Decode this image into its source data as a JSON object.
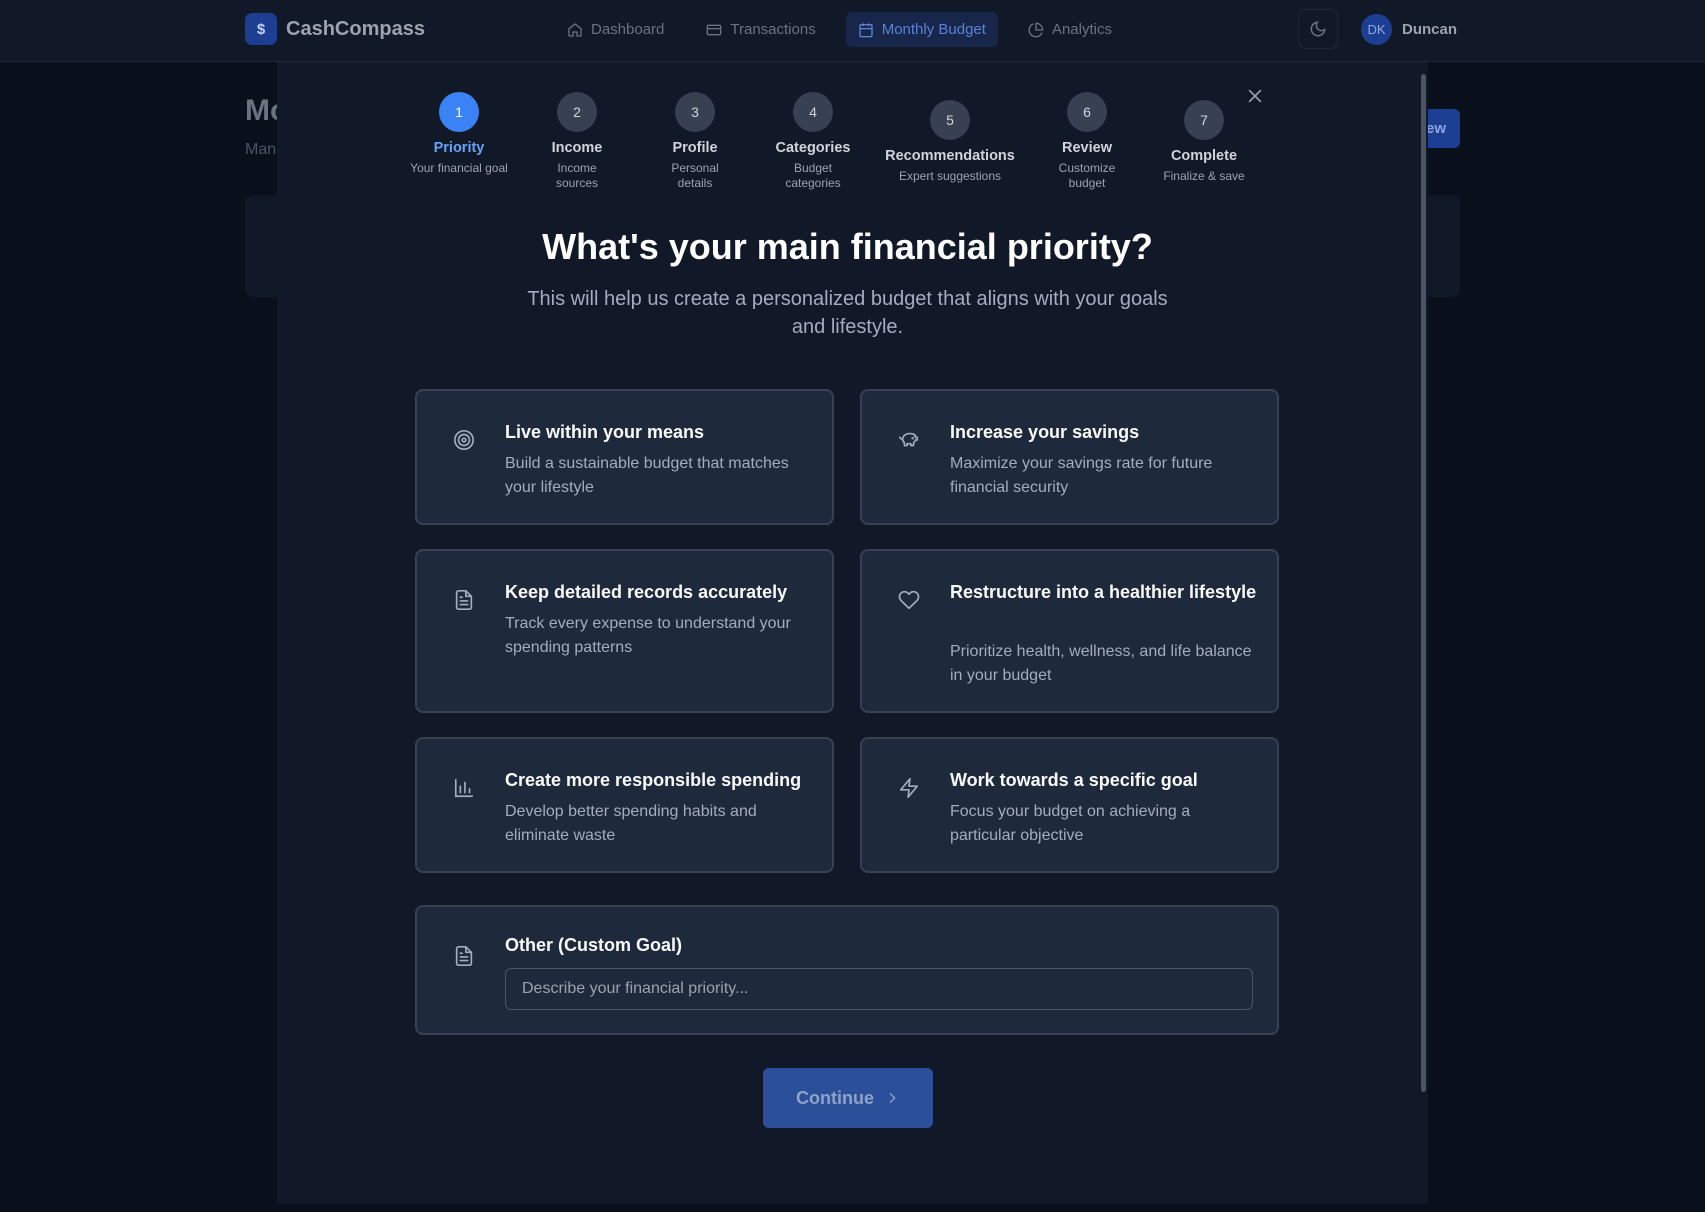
{
  "app": {
    "name": "CashCompass",
    "logo_symbol": "$"
  },
  "nav": {
    "items": [
      {
        "label": "Dashboard",
        "icon": "home-icon"
      },
      {
        "label": "Transactions",
        "icon": "credit-card-icon"
      },
      {
        "label": "Monthly Budget",
        "icon": "calendar-icon",
        "active": true
      },
      {
        "label": "Analytics",
        "icon": "pie-chart-icon"
      }
    ]
  },
  "user": {
    "initials": "DK",
    "name": "Duncan"
  },
  "background": {
    "title": "Mo",
    "subtitle": "Man",
    "button": "ew"
  },
  "wizard": {
    "current_step": 1,
    "steps": [
      {
        "number": "1",
        "label": "Priority",
        "desc": "Your financial goal"
      },
      {
        "number": "2",
        "label": "Income",
        "desc": "Income sources"
      },
      {
        "number": "3",
        "label": "Profile",
        "desc": "Personal details"
      },
      {
        "number": "4",
        "label": "Categories",
        "desc": "Budget categories"
      },
      {
        "number": "5",
        "label": "Recommendations",
        "desc": "Expert suggestions"
      },
      {
        "number": "6",
        "label": "Review",
        "desc": "Customize budget"
      },
      {
        "number": "7",
        "label": "Complete",
        "desc": "Finalize & save"
      }
    ],
    "heading": "What's your main financial priority?",
    "subheading": "This will help us create a personalized budget that aligns with your goals and lifestyle.",
    "options": [
      {
        "title": "Live within your means",
        "desc": "Build a sustainable budget that matches your lifestyle",
        "icon": "target-icon"
      },
      {
        "title": "Increase your savings",
        "desc": "Maximize your savings rate for future financial security",
        "icon": "piggy-bank-icon"
      },
      {
        "title": "Keep detailed records accurately",
        "desc": "Track every expense to understand your spending patterns",
        "icon": "document-icon"
      },
      {
        "title": "Restructure into a healthier lifestyle",
        "desc": "Prioritize health, wellness, and life balance in your budget",
        "icon": "heart-icon"
      },
      {
        "title": "Create more responsible spending",
        "desc": "Develop better spending habits and eliminate waste",
        "icon": "bar-chart-icon"
      },
      {
        "title": "Work towards a specific goal",
        "desc": "Focus your budget on achieving a particular objective",
        "icon": "lightning-icon"
      }
    ],
    "custom": {
      "title": "Other (Custom Goal)",
      "placeholder": "Describe your financial priority...",
      "value": "",
      "icon": "document-icon"
    },
    "continue_label": "Continue"
  },
  "colors": {
    "accent": "#3b82f6",
    "modal_bg": "#111827",
    "card_bg": "#1e293b",
    "page_bg": "#0a0f1c"
  }
}
